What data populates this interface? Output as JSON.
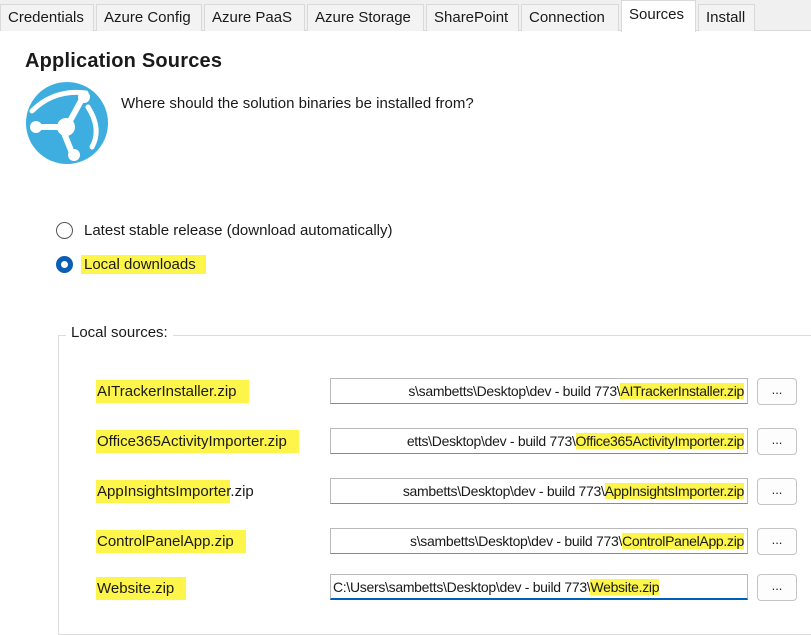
{
  "tabs": [
    {
      "label": "Credentials",
      "active": false
    },
    {
      "label": "Azure Config",
      "active": false
    },
    {
      "label": "Azure PaaS",
      "active": false
    },
    {
      "label": "Azure Storage",
      "active": false
    },
    {
      "label": "SharePoint",
      "active": false
    },
    {
      "label": "Connection",
      "active": false
    },
    {
      "label": "Sources",
      "active": true
    },
    {
      "label": "Install",
      "active": false
    }
  ],
  "header": {
    "title": "Application Sources",
    "subtitle": "Where should the solution binaries be installed from?",
    "logo_icon": "azure-logo-icon"
  },
  "source_options": [
    {
      "label": "Latest stable release (download automatically)",
      "selected": false
    },
    {
      "label": "Local downloads",
      "selected": true
    }
  ],
  "local_sources": {
    "title": "Local sources:",
    "browse_label": "...",
    "items": [
      {
        "label": "AITrackerInstaller.zip",
        "path_visible": "s\\sambetts\\Desktop\\dev - build 773\\",
        "file": "AITrackerInstaller.zip"
      },
      {
        "label": "Office365ActivityImporter.zip",
        "path_visible": "etts\\Desktop\\dev - build 773\\",
        "file": "Office365ActivityImporter.zip"
      },
      {
        "label_highlighted": "AppInsightsImporter",
        "label_rest": ".zip",
        "path_visible": "sambetts\\Desktop\\dev - build 773\\",
        "file": "AppInsightsImporter.zip"
      },
      {
        "label": "ControlPanelApp.zip",
        "path_visible": "s\\sambetts\\Desktop\\dev - build 773\\",
        "file": "ControlPanelApp.zip"
      },
      {
        "label": "Website.zip",
        "path_visible": "C:\\Users\\sambetts\\Desktop\\dev - build 773\\",
        "file": "Website.zip"
      }
    ]
  },
  "colors": {
    "highlight": "#fdf54a",
    "accent": "#0a5fb4",
    "logo": "#3eaee0"
  }
}
